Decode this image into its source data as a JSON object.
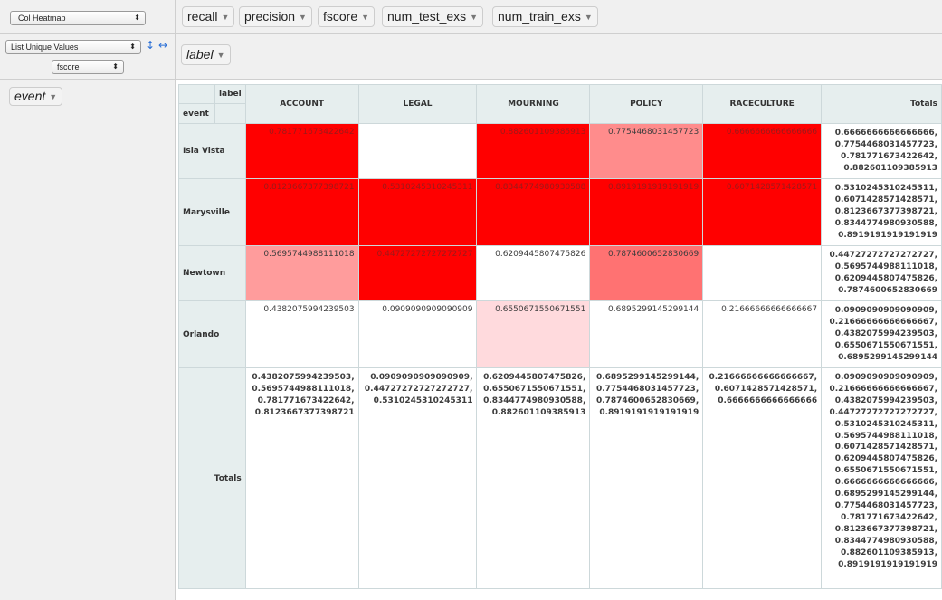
{
  "renderer": {
    "selected": "Col Heatmap"
  },
  "aggregator": {
    "selected": "List Unique Values",
    "attribute": "fscore",
    "row_order_icon": "↕",
    "col_order_icon": "↔"
  },
  "unused_attributes": [
    "recall",
    "precision",
    "fscore",
    "num_test_exs",
    "num_train_exs"
  ],
  "col_attributes": [
    "label"
  ],
  "row_attributes": [
    "event"
  ],
  "table": {
    "col_axis_label": "label",
    "row_axis_label": "event",
    "totals_label": "Totals",
    "columns": [
      "ACCOUNT",
      "LEGAL",
      "MOURNING",
      "POLICY",
      "RACECULTURE"
    ],
    "rows": [
      {
        "label": "Isla Vista",
        "cells": [
          "0.781771673422642",
          "",
          "0.882601109385913",
          "0.7754468031457723",
          "0.6666666666666666"
        ],
        "total": "0.6666666666666666,\n0.7754468031457723,\n0.781771673422642,\n0.882601109385913"
      },
      {
        "label": "Marysville",
        "cells": [
          "0.8123667377398721",
          "0.5310245310245311",
          "0.8344774980930588",
          "0.8919191919191919",
          "0.6071428571428571"
        ],
        "total": "0.5310245310245311,\n0.6071428571428571,\n0.8123667377398721,\n0.8344774980930588,\n0.8919191919191919"
      },
      {
        "label": "Newtown",
        "cells": [
          "0.5695744988111018",
          "0.44727272727272727",
          "0.6209445807475826",
          "0.7874600652830669",
          ""
        ],
        "total": "0.44727272727272727,\n0.5695744988111018,\n0.6209445807475826,\n0.7874600652830669"
      },
      {
        "label": "Orlando",
        "cells": [
          "0.4382075994239503",
          "0.0909090909090909",
          "0.6550671550671551",
          "0.6895299145299144",
          "0.21666666666666667"
        ],
        "total": "0.0909090909090909,\n0.21666666666666667,\n0.4382075994239503,\n0.6550671550671551,\n0.6895299145299144"
      }
    ],
    "col_totals": [
      "0.4382075994239503,\n0.5695744988111018,\n0.781771673422642,\n0.8123667377398721",
      "0.0909090909090909,\n0.44727272727272727,\n0.5310245310245311",
      "0.6209445807475826,\n0.6550671550671551,\n0.8344774980930588,\n0.882601109385913",
      "0.6895299145299144,\n0.7754468031457723,\n0.7874600652830669,\n0.8919191919191919",
      "0.21666666666666667,\n0.6071428571428571,\n0.6666666666666666"
    ],
    "grand_total": "0.0909090909090909,\n0.21666666666666667,\n0.4382075994239503,\n0.44727272727272727,\n0.5310245310245311,\n0.5695744988111018,\n0.6071428571428571,\n0.6209445807475826,\n0.6550671550671551,\n0.6666666666666666,\n0.6895299145299144,\n0.7754468031457723,\n0.781771673422642,\n0.8123667377398721,\n0.8344774980930588,\n0.882601109385913,\n0.8919191919191919",
    "cell_colors": [
      [
        "#ff0000",
        "#ffffff",
        "#ff0000",
        "#ff8c8c",
        "#ff0000"
      ],
      [
        "#ff0000",
        "#ff0000",
        "#ff0000",
        "#ff0000",
        "#ff0000"
      ],
      [
        "#ff9c9c",
        "#ff0000",
        "#ffffff",
        "#ff7272",
        "#ffffff"
      ],
      [
        "#ffffff",
        "#ffffff",
        "#ffdadd",
        "#ffffff",
        "#ffffff"
      ]
    ],
    "dim_text_cells": [
      [
        true,
        false,
        true,
        false,
        true
      ],
      [
        true,
        true,
        true,
        true,
        true
      ],
      [
        false,
        true,
        false,
        false,
        false
      ],
      [
        false,
        false,
        false,
        false,
        false
      ]
    ]
  }
}
